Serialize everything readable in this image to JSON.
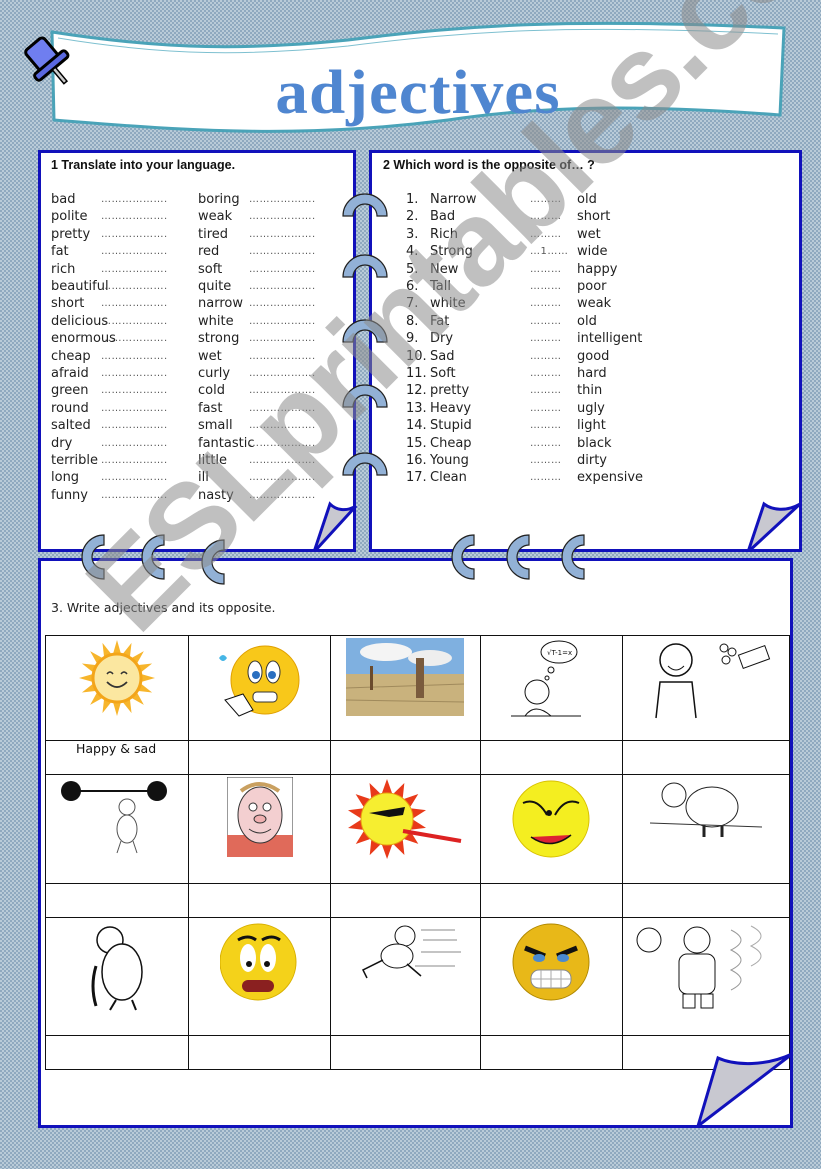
{
  "title": "adjectives",
  "colors": {
    "title": "#4f86d0",
    "frame": "#1111bb",
    "banner_border": "#4aa3b8",
    "ring": "#92b1d6"
  },
  "section1": {
    "heading": "1 Translate into your language.",
    "left_words": [
      "bad",
      "polite",
      "pretty",
      "fat",
      "rich",
      "beautiful",
      "short",
      "delicious",
      "enormous",
      "cheap",
      "afraid",
      "green",
      "round",
      "salted",
      "dry",
      "terrible",
      "long",
      "funny"
    ],
    "right_words": [
      "boring",
      "weak",
      "tired",
      "red",
      "soft",
      "quite",
      "narrow",
      "white",
      "strong",
      "wet",
      "curly",
      "cold",
      "fast",
      "small",
      "fantastic",
      "little",
      "ill",
      "nasty"
    ],
    "blank": "………………."
  },
  "section2": {
    "heading": "2 Which word is the opposite of… ?",
    "items": [
      {
        "num": "1.",
        "word": "Narrow",
        "answer": "………",
        "opposite": "old"
      },
      {
        "num": "2.",
        "word": "Bad",
        "answer": "………",
        "opposite": "short"
      },
      {
        "num": "3.",
        "word": "Rich",
        "answer": "………",
        "opposite": "wet"
      },
      {
        "num": "4.",
        "word": "Strong",
        "answer": "…1……",
        "opposite": "wide"
      },
      {
        "num": "5.",
        "word": "New",
        "answer": "………",
        "opposite": "happy"
      },
      {
        "num": "6.",
        "word": "Tall",
        "answer": "………",
        "opposite": "poor"
      },
      {
        "num": "7.",
        "word": "white",
        "answer": "………",
        "opposite": "weak"
      },
      {
        "num": "8.",
        "word": "Fat",
        "answer": "………",
        "opposite": "old"
      },
      {
        "num": "9.",
        "word": "Dry",
        "answer": "………",
        "opposite": "intelligent"
      },
      {
        "num": "10.",
        "word": "Sad",
        "answer": "………",
        "opposite": "good"
      },
      {
        "num": "11.",
        "word": "Soft",
        "answer": "………",
        "opposite": "hard"
      },
      {
        "num": "12.",
        "word": "pretty",
        "answer": "………",
        "opposite": "thin"
      },
      {
        "num": "13.",
        "word": "Heavy",
        "answer": "………",
        "opposite": "ugly"
      },
      {
        "num": "14.",
        "word": "Stupid",
        "answer": "………",
        "opposite": "light"
      },
      {
        "num": "15.",
        "word": "Cheap",
        "answer": "………",
        "opposite": "black"
      },
      {
        "num": "16.",
        "word": "Young",
        "answer": "………",
        "opposite": "dirty"
      },
      {
        "num": "17.",
        "word": "Clean",
        "answer": "………",
        "opposite": "expensive"
      }
    ]
  },
  "section3": {
    "heading": "3.  Write adjectives and its opposite.",
    "rows": [
      {
        "images": [
          "smiling-sun",
          "nervous-smiley-watch",
          "dry-landscape",
          "thinking-boy",
          "rich-boy-money"
        ],
        "answers": [
          "Happy  & sad",
          "",
          "",
          "",
          ""
        ]
      },
      {
        "images": [
          "strong-man-barbell",
          "ugly-man-face",
          "hot-sun-thermometer",
          "angry-smiley",
          "slow-turtle"
        ],
        "answers": [
          "",
          "",
          "",
          "",
          ""
        ]
      },
      {
        "images": [
          "old-man-cane",
          "surprised-smiley",
          "running-man-fast",
          "angry-smiley-teeth",
          "cold-people-snow"
        ],
        "answers": [
          "",
          "",
          "",
          "",
          ""
        ]
      }
    ]
  },
  "watermark": "ESLprintables.com"
}
